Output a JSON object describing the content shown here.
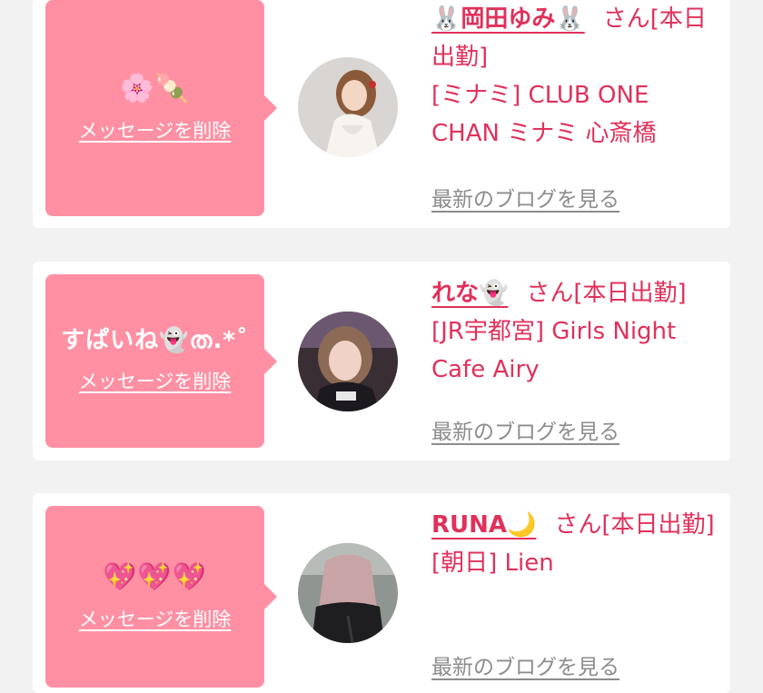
{
  "entries": [
    {
      "message": "🌸🍡",
      "delete_label": "メッセージを削除",
      "name": "🐰岡田ゆみ🐰",
      "san_label": "さん[本日出勤]",
      "shop": "[ミナミ] CLUB ONE CHAN ミナミ 心斎橋",
      "blog_label": "最新のブログを見る"
    },
    {
      "message": "すぱいね👻ത.*˚",
      "delete_label": "メッセージを削除",
      "name": "れな👻",
      "san_label": "さん[本日出勤]",
      "shop": "[JR宇都宮] Girls Night Cafe Airy",
      "blog_label": "最新のブログを見る"
    },
    {
      "message": "💖💖💖",
      "delete_label": "メッセージを削除",
      "name": "RUNA🌙",
      "san_label": "さん[本日出勤]",
      "shop": "[朝日] Lien",
      "blog_label": "最新のブログを見る"
    }
  ],
  "colors": {
    "accent": "#e0315b",
    "message_bg": "#ff90a4",
    "page_bg": "#f2f2f2",
    "link_gray": "#8c8c8c"
  }
}
